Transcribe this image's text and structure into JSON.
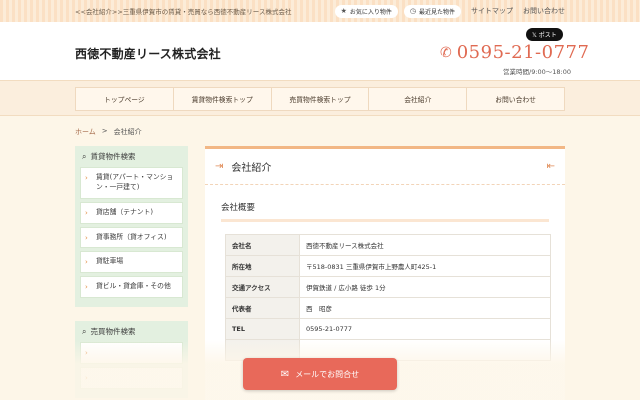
{
  "topbar": {
    "tagline": "<<会社紹介>>三重県伊賀市の賃貸・売買なら西徳不動産リース株式会社",
    "favorites": "お気に入り物件",
    "recent": "最近見た物件",
    "sitemap": "サイトマップ",
    "contact": "お問い合わせ"
  },
  "header": {
    "company": "西徳不動産リース株式会社",
    "post": "ポスト",
    "phone": "0595-21-0777",
    "hours": "営業時間/9:00～18:00"
  },
  "nav": [
    "トップページ",
    "賃貸物件検索トップ",
    "売買物件検索トップ",
    "会社紹介",
    "お問い合わせ"
  ],
  "breadcrumb": {
    "home": "ホーム",
    "sep": ">",
    "current": "会社紹介"
  },
  "sidebar": {
    "rent": {
      "heading": "賃貸物件検索",
      "items": [
        "賃貸(アパート・マンション・一戸建て)",
        "貸店舗（テナント)",
        "貸事務所（貸オフィス)",
        "貸駐車場",
        "貸ビル・貸倉庫・その他"
      ]
    },
    "sale": {
      "heading": "売買物件検索"
    }
  },
  "main": {
    "title": "会社紹介",
    "section": "会社概要",
    "rows": [
      {
        "key": "会社名",
        "value": "西徳不動産リース株式会社"
      },
      {
        "key": "所在地",
        "value": "〒518-0831 三重県伊賀市上野農人町425-1"
      },
      {
        "key": "交通アクセス",
        "value": "伊賀鉄道 / 広小路 徒歩 1分"
      },
      {
        "key": "代表者",
        "value": "西　昭彦"
      },
      {
        "key": "TEL",
        "value": "0595-21-0777"
      }
    ]
  },
  "cta": {
    "label": "メールでお問合せ"
  },
  "colors": {
    "accent": "#e8695a",
    "phone": "#e06a52",
    "sidebar": "#e3f0e0",
    "topbar": "#fbe0c4"
  }
}
